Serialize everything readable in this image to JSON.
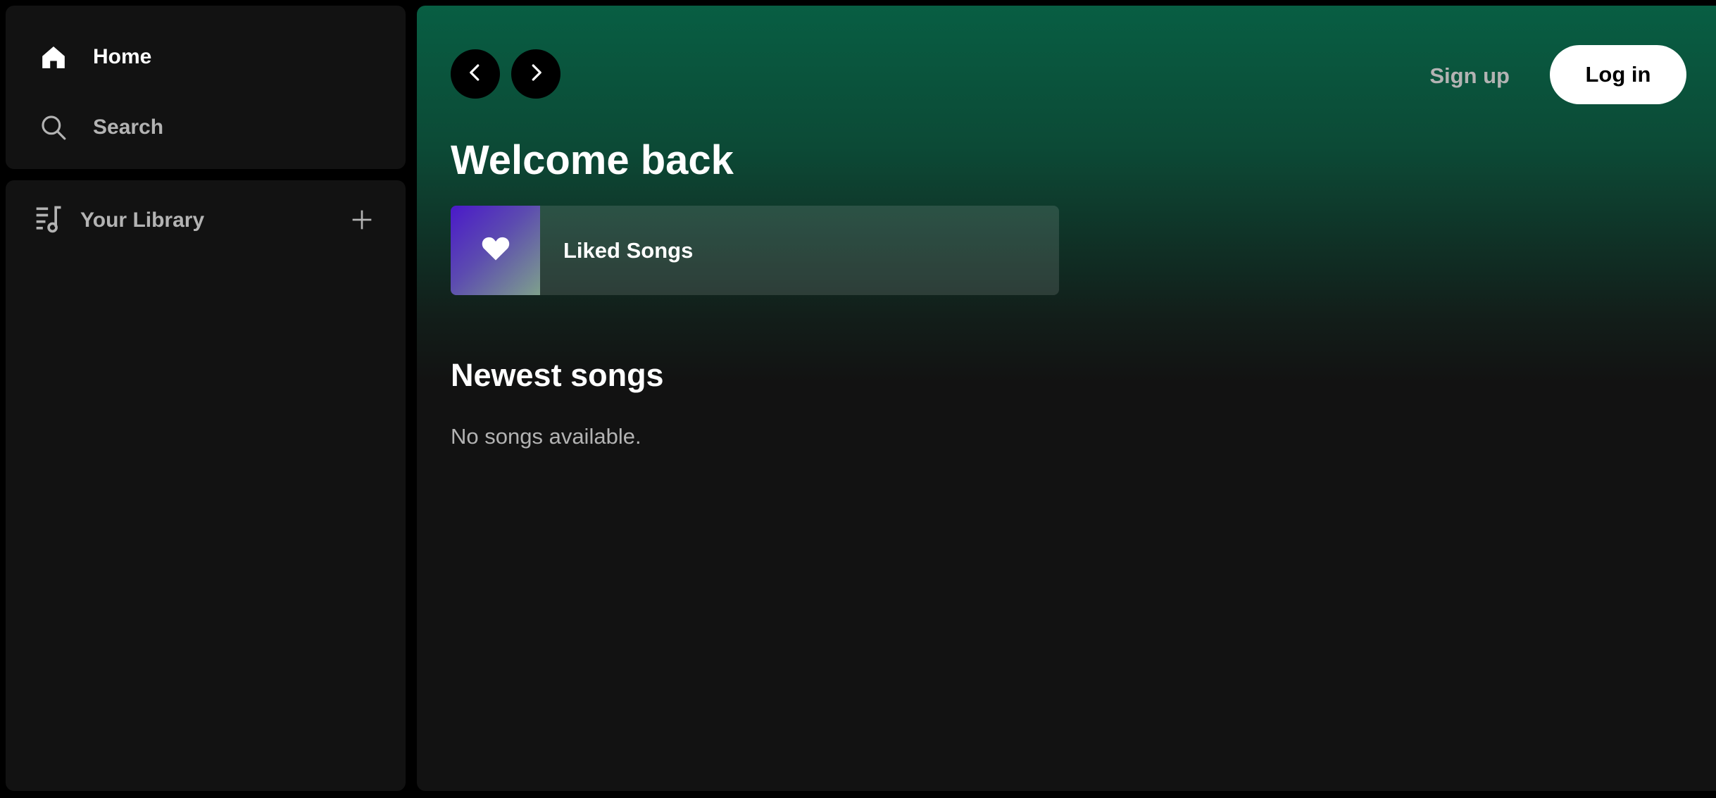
{
  "sidebar": {
    "nav": [
      {
        "label": "Home",
        "icon": "home-icon"
      },
      {
        "label": "Search",
        "icon": "search-icon"
      }
    ],
    "library": {
      "label": "Your Library",
      "icon": "library-icon",
      "add_icon": "plus-icon"
    }
  },
  "header": {
    "back_icon": "chevron-left-icon",
    "forward_icon": "chevron-right-icon",
    "signup_label": "Sign up",
    "login_label": "Log in"
  },
  "main": {
    "greeting": "Welcome back",
    "liked_songs": {
      "label": "Liked Songs",
      "icon": "heart-icon"
    },
    "newest": {
      "title": "Newest songs",
      "empty_text": "No songs available."
    }
  },
  "colors": {
    "accent_gradient_top": "#085e43",
    "background": "#121212",
    "muted_text": "#b3b3b3"
  }
}
